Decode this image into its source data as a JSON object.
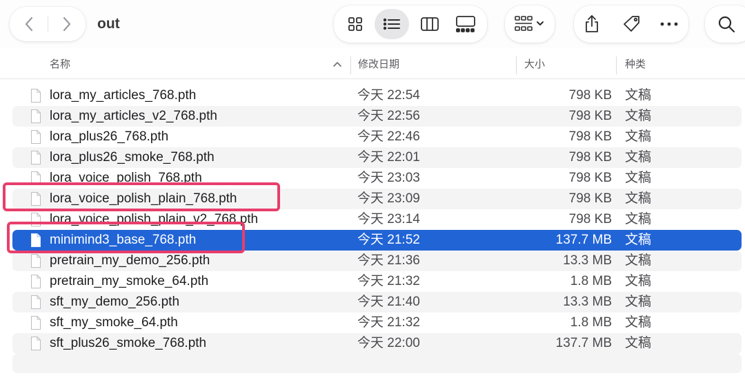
{
  "window": {
    "title": "out"
  },
  "toolbar": {
    "back_icon": "chevron-left-icon",
    "forward_icon": "chevron-right-icon",
    "views": [
      "icon-view",
      "list-view",
      "column-view",
      "gallery-view"
    ],
    "active_view": "list-view",
    "group_icon": "group-by-icon",
    "share_icon": "share-icon",
    "tag_icon": "tag-icon",
    "more_icon": "ellipsis-icon",
    "search_icon": "search-icon"
  },
  "columns": {
    "name": "名称",
    "date": "修改日期",
    "size": "大小",
    "kind": "种类",
    "sort": "ascending"
  },
  "files": [
    {
      "name": "lora_my_articles_768.pth",
      "date": "今天 22:54",
      "size": "798 KB",
      "kind": "文稿"
    },
    {
      "name": "lora_my_articles_v2_768.pth",
      "date": "今天 22:56",
      "size": "798 KB",
      "kind": "文稿"
    },
    {
      "name": "lora_plus26_768.pth",
      "date": "今天 22:46",
      "size": "798 KB",
      "kind": "文稿"
    },
    {
      "name": "lora_plus26_smoke_768.pth",
      "date": "今天 22:01",
      "size": "798 KB",
      "kind": "文稿"
    },
    {
      "name": "lora_voice_polish_768.pth",
      "date": "今天 23:03",
      "size": "798 KB",
      "kind": "文稿"
    },
    {
      "name": "lora_voice_polish_plain_768.pth",
      "date": "今天 23:09",
      "size": "798 KB",
      "kind": "文稿"
    },
    {
      "name": "lora_voice_polish_plain_v2_768.pth",
      "date": "今天 23:14",
      "size": "798 KB",
      "kind": "文稿"
    },
    {
      "name": "minimind3_base_768.pth",
      "date": "今天 21:52",
      "size": "137.7 MB",
      "kind": "文稿"
    },
    {
      "name": "pretrain_my_demo_256.pth",
      "date": "今天 21:36",
      "size": "13.3 MB",
      "kind": "文稿"
    },
    {
      "name": "pretrain_my_smoke_64.pth",
      "date": "今天 21:32",
      "size": "1.8 MB",
      "kind": "文稿"
    },
    {
      "name": "sft_my_demo_256.pth",
      "date": "今天 21:40",
      "size": "13.3 MB",
      "kind": "文稿"
    },
    {
      "name": "sft_my_smoke_64.pth",
      "date": "今天 21:32",
      "size": "1.8 MB",
      "kind": "文稿"
    },
    {
      "name": "sft_plus26_smoke_768.pth",
      "date": "今天 22:00",
      "size": "137.7 MB",
      "kind": "文稿"
    }
  ],
  "selected_file": "minimind3_base_768.pth",
  "colors": {
    "selection": "#2164d6",
    "annotation": "#e83e6c",
    "alt_row": "#f4f4f5"
  }
}
